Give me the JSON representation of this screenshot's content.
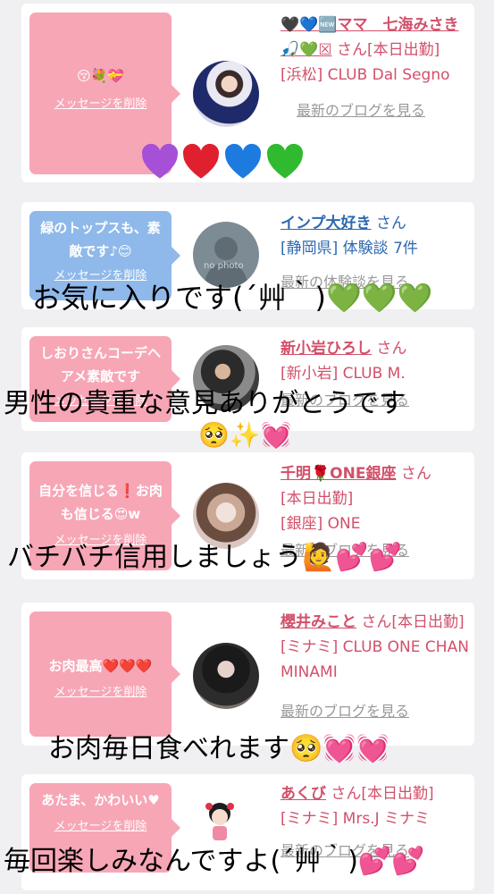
{
  "cards": [
    {
      "bubble": {
        "msg": "😚💐💝",
        "delete": "メッセージを削除"
      },
      "name": "🖤💙🆕ママ　七海みさき🎣💚☒",
      "suffix": "さん[本日出勤]",
      "line2": "[浜松] CLUB Dal Segno",
      "blog": "最新のブログを見る"
    },
    {
      "bubble": {
        "msg": "緑のトップスも、素敵です♪😊",
        "delete": "メッセージを削除"
      },
      "name": "インプ大好き",
      "suffix": "さん",
      "line2": "[静岡県] 体験談 7件",
      "blog": "最新の体験談を見る",
      "avatar_label": "no photo"
    },
    {
      "bubble": {
        "msg": "しおりさんコーデヘアメ素敵です",
        "delete": "メッセージを削除"
      },
      "name": "新小岩ひろし",
      "suffix": "さん",
      "line2": "[新小岩] CLUB M.",
      "blog": "最新のブログを見る"
    },
    {
      "bubble": {
        "msg": "自分を信じる❗お肉も信じる😍w",
        "delete": "メッセージを削除"
      },
      "name": "千明🌹ONE銀座",
      "suffix": "さん",
      "line2": "[本日出勤]",
      "line3": "[銀座] ONE",
      "blog": "最新のブログを見る"
    },
    {
      "bubble": {
        "msg": "お肉最高❤️❤️❤️",
        "delete": "メッセージを削除"
      },
      "name": "櫻井みこと",
      "suffix": "さん[本日出勤]",
      "line2": "[ミナミ] CLUB ONE CHAN MINAMI",
      "blog": "最新のブログを見る"
    },
    {
      "bubble": {
        "msg": "あたま、かわいい♥",
        "delete": "メッセージを削除"
      },
      "name": "あくび",
      "suffix": "さん[本日出勤]",
      "line2": "[ミナミ] Mrs.J ミナミ",
      "blog": "最新のブログを見る"
    }
  ],
  "overlays": [
    "お気に入りです(´艸｀)💚💚💚",
    "男性の貴重な意見ありがとうです",
    "🥺✨💓",
    "バチバチ信用しましょう🙋💕💕",
    "お肉毎日食べれます🥺💓💓",
    "毎回楽しみなんですよ(´艸｀)💕💕"
  ],
  "heart_stickers": [
    "purple",
    "red",
    "blue",
    "green"
  ],
  "colors": {
    "pink_bubble": "#f7a6b6",
    "blue_bubble": "#8eb9ea",
    "name_pink": "#d2506a",
    "name_blue": "#2d69b0"
  }
}
